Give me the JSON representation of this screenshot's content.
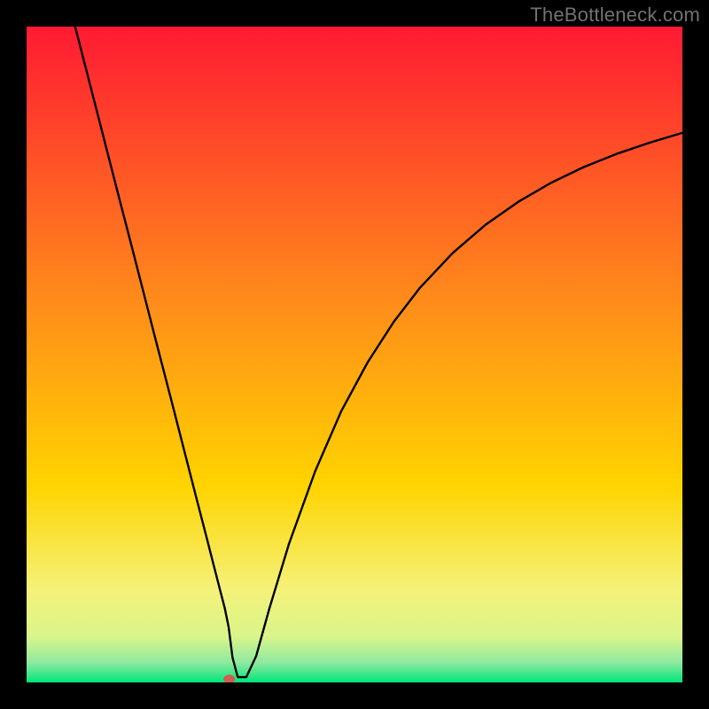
{
  "watermark": "TheBottleneck.com",
  "chart_data": {
    "type": "line",
    "title": "",
    "xlabel": "",
    "ylabel": "",
    "xlim": [
      0,
      100
    ],
    "ylim": [
      0,
      100
    ],
    "grid": false,
    "legend": false,
    "background_gradient": {
      "top_color": "#ff1a33",
      "mid_color": "#ffd400",
      "bottom_color": "#00e57a"
    },
    "marker": {
      "x": 30.9,
      "y": 0.5,
      "color": "#d35b51"
    },
    "series": [
      {
        "name": "bottleneck-curve",
        "x": [
          7.4,
          10,
          12,
          14,
          16,
          18,
          20,
          22,
          24,
          26,
          27.5,
          28.7,
          29.5,
          30.2,
          30.8,
          31.4,
          32.2,
          33.5,
          35,
          37,
          40,
          44,
          48,
          52,
          56,
          60,
          65,
          70,
          75,
          80,
          85,
          90,
          95,
          100
        ],
        "y": [
          100,
          89.9,
          82.1,
          74.3,
          66.6,
          58.8,
          51.0,
          43.3,
          35.5,
          27.7,
          21.9,
          17.2,
          14.1,
          11.4,
          8.5,
          3.8,
          0.8,
          0.8,
          4.0,
          11.2,
          21.1,
          32.2,
          41.4,
          48.8,
          55.0,
          60.2,
          65.5,
          69.8,
          73.3,
          76.2,
          78.6,
          80.6,
          82.3,
          83.8
        ]
      }
    ]
  }
}
